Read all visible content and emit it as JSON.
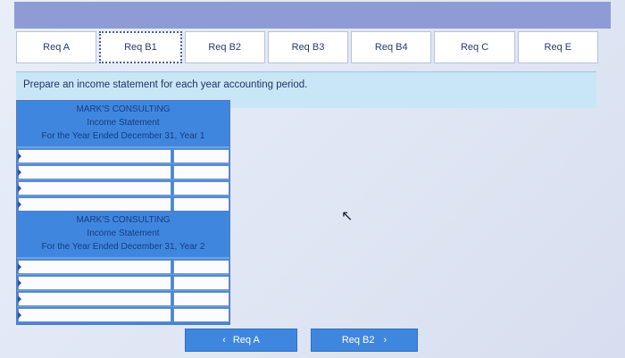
{
  "tabs": [
    {
      "label": "Req A"
    },
    {
      "label": "Req B1"
    },
    {
      "label": "Req B2"
    },
    {
      "label": "Req B3"
    },
    {
      "label": "Req B4"
    },
    {
      "label": "Req C"
    },
    {
      "label": "Req E"
    }
  ],
  "instruction": "Prepare an income statement for each year accounting period.",
  "statement1": {
    "company": "MARK'S CONSULTING",
    "title": "Income Statement",
    "period": "For the Year Ended December 31, Year 1"
  },
  "statement2": {
    "company": "MARK'S CONSULTING",
    "title": "Income Statement",
    "period": "For the Year Ended December 31, Year 2"
  },
  "nav": {
    "prev_label": "Req A",
    "next_label": "Req B2",
    "prev_icon": "chevron-left-icon",
    "next_icon": "chevron-right-icon"
  },
  "colors": {
    "tab_bar": "#8f9bd4",
    "instruction_bg": "#c9e6f6",
    "table_blue": "#3f87de"
  }
}
